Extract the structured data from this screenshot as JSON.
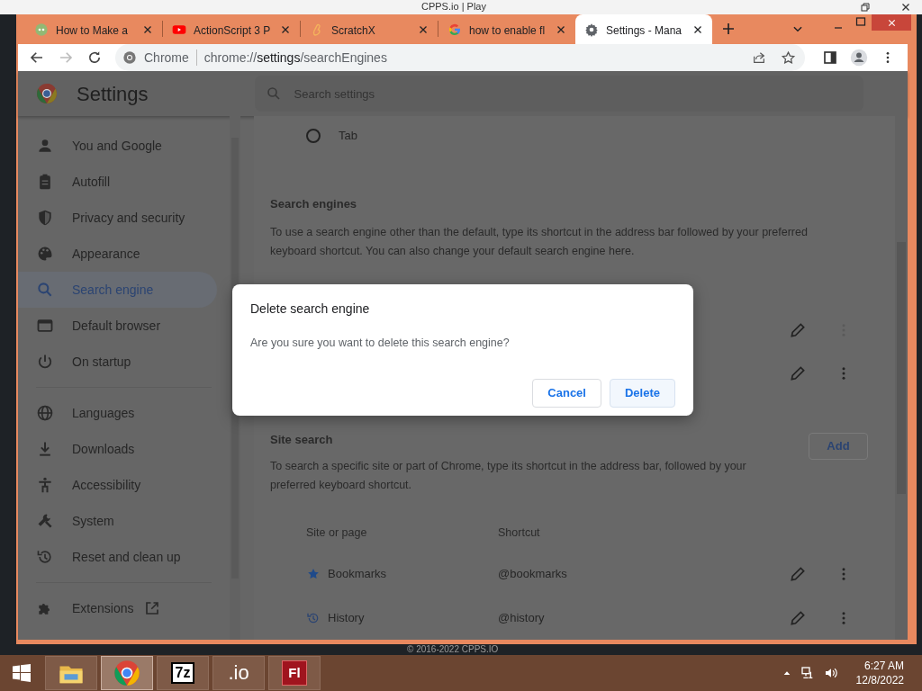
{
  "background_window": {
    "title": "CPPS.io | Play"
  },
  "browser": {
    "tabs": [
      {
        "kind": "wikihow",
        "title": "How to Make a",
        "selected": false
      },
      {
        "kind": "youtube",
        "title": "ActionScript 3 P",
        "selected": false
      },
      {
        "kind": "scratchx",
        "title": "ScratchX",
        "selected": false
      },
      {
        "kind": "google",
        "title": "how to enable fl",
        "selected": false
      },
      {
        "kind": "settings",
        "title": "Settings - Mana",
        "selected": true
      }
    ],
    "omnibox": {
      "chip": "Chrome",
      "scheme": "chrome://",
      "host": "settings",
      "path": "/searchEngines"
    }
  },
  "settings": {
    "title": "Settings",
    "search": {
      "placeholder": "Search settings"
    },
    "sidebar": {
      "groups": [
        [
          {
            "kind": "person",
            "label": "You and Google",
            "selected": false
          },
          {
            "kind": "clipboard",
            "label": "Autofill",
            "selected": false
          },
          {
            "kind": "shield",
            "label": "Privacy and security",
            "selected": false
          },
          {
            "kind": "palette",
            "label": "Appearance",
            "selected": false
          },
          {
            "kind": "search",
            "label": "Search engine",
            "selected": true
          },
          {
            "kind": "browser",
            "label": "Default browser",
            "selected": false
          },
          {
            "kind": "power",
            "label": "On startup",
            "selected": false
          }
        ],
        [
          {
            "kind": "globe",
            "label": "Languages",
            "selected": false
          },
          {
            "kind": "download",
            "label": "Downloads",
            "selected": false
          },
          {
            "kind": "accessibility",
            "label": "Accessibility",
            "selected": false
          },
          {
            "kind": "wrench",
            "label": "System",
            "selected": false
          },
          {
            "kind": "history",
            "label": "Reset and clean up",
            "selected": false
          }
        ],
        [
          {
            "kind": "puzzle",
            "label": "Extensions",
            "selected": false,
            "external": true
          }
        ]
      ]
    },
    "radio": {
      "label": "Tab",
      "checked": false
    },
    "search_engines": {
      "heading": "Search engines",
      "description": "To use a search engine other than the default, type its shortcut in the address bar followed by your preferred keyboard shortcut. You can also change your default search engine here.",
      "rows": [
        {
          "menu_disabled": true
        },
        {
          "menu_disabled": false
        }
      ]
    },
    "site_search": {
      "heading": "Site search",
      "add_button": "Add",
      "description": "To search a specific site or part of Chrome, type its shortcut in the address bar, followed by your preferred keyboard shortcut.",
      "columns": [
        "Site or page",
        "Shortcut"
      ],
      "rows": [
        {
          "kind": "star",
          "name": "Bookmarks",
          "shortcut": "@bookmarks"
        },
        {
          "kind": "history",
          "name": "History",
          "shortcut": "@history"
        }
      ]
    },
    "dialog": {
      "title": "Delete search engine",
      "message": "Are you sure you want to delete this search engine?",
      "buttons": [
        {
          "kind": "secondary",
          "label": "Cancel"
        },
        {
          "kind": "primary",
          "label": "Delete"
        }
      ]
    }
  },
  "footer": "© 2016-2022 CPPS.IO",
  "taskbar": {
    "apps": [
      {
        "kind": "explorer",
        "selected": false
      },
      {
        "kind": "chrome",
        "selected": true
      },
      {
        "kind": "sevenzip",
        "label": "7z",
        "selected": false
      },
      {
        "kind": "io",
        "label": ".io",
        "selected": false
      },
      {
        "kind": "flash",
        "label": "Fl",
        "selected": false
      }
    ],
    "time": "6:27 AM",
    "date": "12/8/2022"
  }
}
